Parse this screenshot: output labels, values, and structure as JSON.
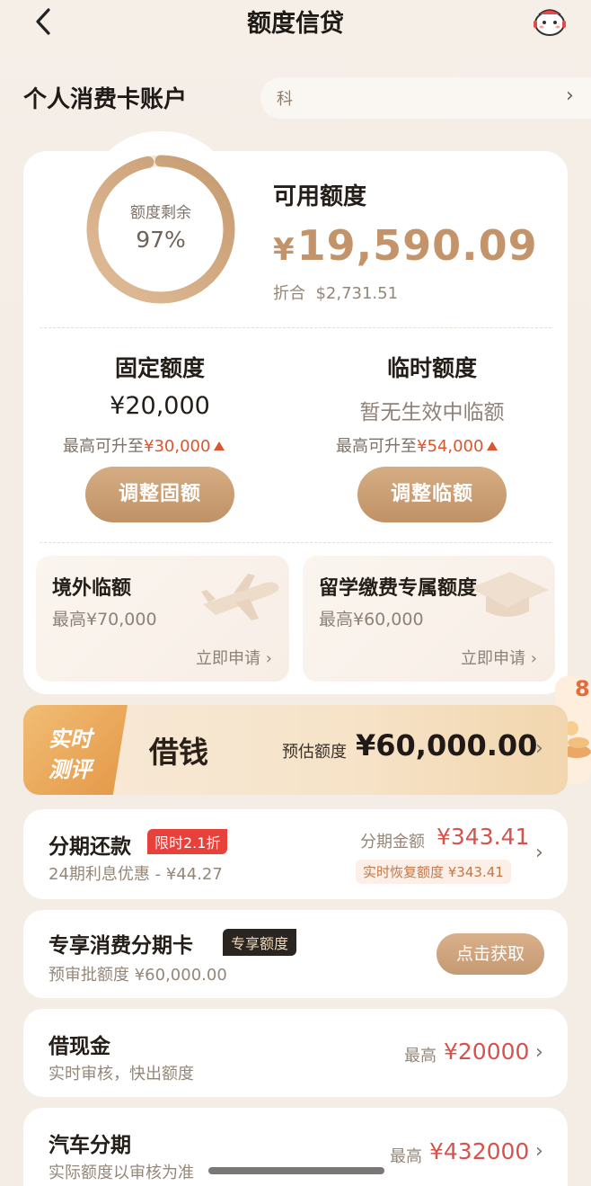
{
  "header": {
    "title": "额度信贷",
    "back_icon": "chevron-left-icon",
    "mascot_icon": "mascot-icon"
  },
  "account": {
    "title": "个人消费卡账户",
    "selector_value": "科",
    "selector_chevron": "›"
  },
  "summary": {
    "ring_label": "额度剩余",
    "ring_percent": "97%",
    "ring_fraction": 0.97,
    "available_label": "可用额度",
    "available_currency": "¥",
    "available_amount": "19,590.09",
    "converted_label": "折合",
    "converted_amount": "$2,731.51"
  },
  "fixed": {
    "title": "固定额度",
    "value": "¥20,000",
    "max_prefix": "最高可升至",
    "max_value": "¥30,000",
    "button": "调整固额"
  },
  "temp": {
    "title": "临时额度",
    "value": "暂无生效中临额",
    "max_prefix": "最高可升至",
    "max_value": "¥54,000",
    "button": "调整临额"
  },
  "overseas": {
    "title": "境外临额",
    "sub": "最高¥70,000",
    "action": "立即申请 ›"
  },
  "study": {
    "title": "留学缴费专属额度",
    "sub": "最高¥60,000",
    "action": "立即申请 ›"
  },
  "banner": {
    "badge_line1": "实时",
    "badge_line2": "测评",
    "title": "借钱",
    "estimate_label": "预估额度",
    "estimate_amount": "¥60,000.00",
    "chevron": "›",
    "side_deco": "8"
  },
  "installment": {
    "title": "分期还款",
    "tag": "限时2.1折",
    "sub": "24期利息优惠 - ¥44.27",
    "amount_label": "分期金额",
    "amount": "¥343.41",
    "chip": "实时恢复额度 ¥343.41",
    "chevron": "›"
  },
  "exclusive": {
    "title": "专享消费分期卡",
    "tag": "专享额度",
    "sub": "预审批额度 ¥60,000.00",
    "button": "点击获取"
  },
  "cash": {
    "title": "借现金",
    "sub": "实时审核，快出额度",
    "max_label": "最高",
    "max_value": "¥20000",
    "chevron": "›"
  },
  "car": {
    "title": "汽车分期",
    "sub": "实际额度以审核为准",
    "max_label": "最高",
    "max_value": "¥432000",
    "chevron": "›"
  },
  "colors": {
    "accent": "#c3946a",
    "red": "#d9572f",
    "bg": "#f3ede6"
  }
}
